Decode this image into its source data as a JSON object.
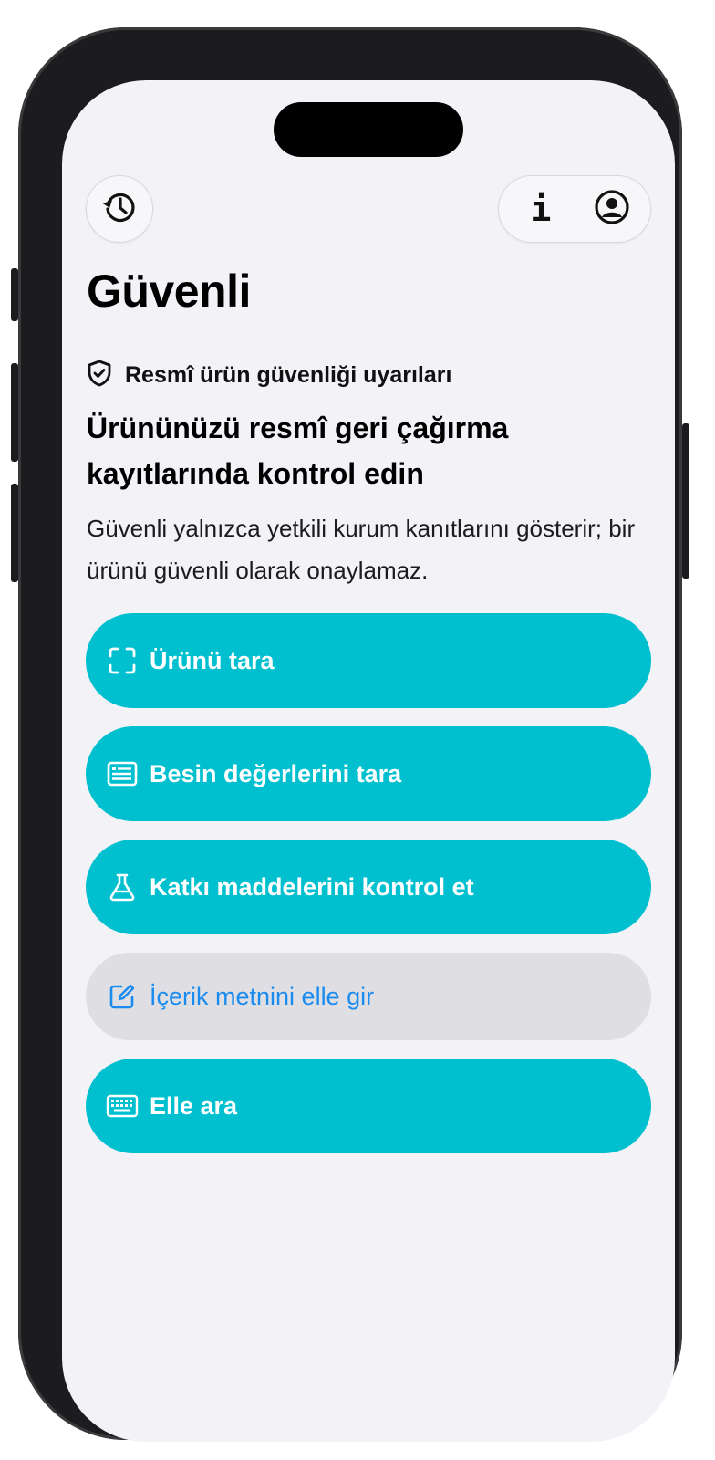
{
  "header": {
    "history_icon": "clock-arrow-history-icon",
    "info_icon": "info-icon",
    "profile_icon": "person-circle-icon"
  },
  "page": {
    "title": "Güvenli"
  },
  "intro": {
    "eyebrow_icon": "shield-check-icon",
    "eyebrow": "Resmî ürün güvenliği uyarıları",
    "headline": "Ürününüzü resmî geri çağırma kayıtlarında kontrol edin",
    "description": "Güvenli yalnızca yetkili kurum kanıtlarını gösterir; bir ürünü güvenli olarak onaylamaz."
  },
  "actions": [
    {
      "label": "Ürünü tara",
      "icon": "scan-frame-icon",
      "style": "primary"
    },
    {
      "label": "Besin değerlerini tara",
      "icon": "document-text-icon",
      "style": "primary"
    },
    {
      "label": "Katkı maddelerini kontrol et",
      "icon": "flask-icon",
      "style": "primary"
    },
    {
      "label": "İçerik metnini elle gir",
      "icon": "edit-square-icon",
      "style": "secondary"
    },
    {
      "label": "Elle ara",
      "icon": "keyboard-icon",
      "style": "primary"
    }
  ],
  "colors": {
    "accent": "#00c0d0",
    "secondary_bg": "#dedee3",
    "link": "#1a8cf0",
    "background": "#f2f2f7"
  }
}
